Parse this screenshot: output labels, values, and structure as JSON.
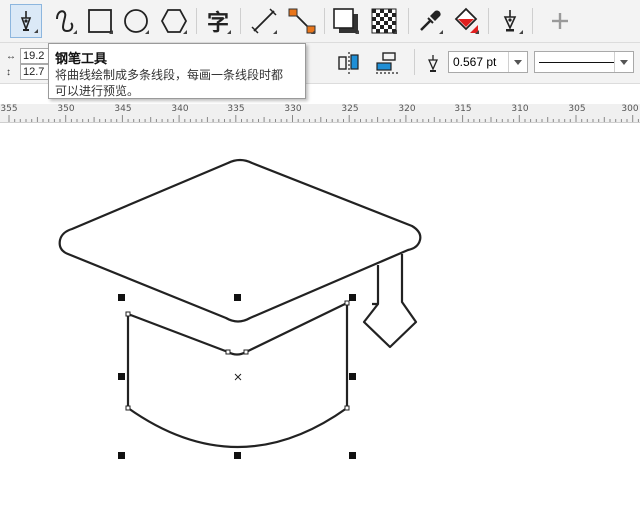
{
  "toolbar": {
    "tools": [
      {
        "name": "pen-tool-icon",
        "active": true
      },
      {
        "name": "curve-tool-icon"
      },
      {
        "name": "rectangle-tool-icon"
      },
      {
        "name": "ellipse-tool-icon"
      },
      {
        "name": "polygon-tool-icon"
      },
      {
        "name": "text-tool-icon",
        "glyph": "字"
      },
      {
        "name": "dimension-tool-icon"
      },
      {
        "name": "connector-tool-icon"
      },
      {
        "name": "drop-shadow-tool-icon"
      },
      {
        "name": "transparency-tool-icon"
      },
      {
        "name": "eyedropper-tool-icon"
      },
      {
        "name": "interactive-fill-tool-icon"
      },
      {
        "name": "outline-pen-icon"
      },
      {
        "name": "add-tool-icon"
      }
    ]
  },
  "propbar": {
    "width_value": "19.2",
    "height_value": "12.7",
    "outline_width": "0.567 pt"
  },
  "tooltip": {
    "title": "钢笔工具",
    "description_line1": "将曲线绘制成多条线段，每画一条线段时都",
    "description_line2": "可以进行预览。"
  },
  "ruler": {
    "labels": [
      "355",
      "350",
      "345",
      "340",
      "335",
      "330",
      "325",
      "320",
      "315",
      "310",
      "305",
      "300"
    ]
  },
  "colors": {
    "accent_active": "#dbe9f7",
    "connector_orange": "#e8751a",
    "fill_red": "#e02020",
    "align_blue": "#1f8fd6"
  }
}
